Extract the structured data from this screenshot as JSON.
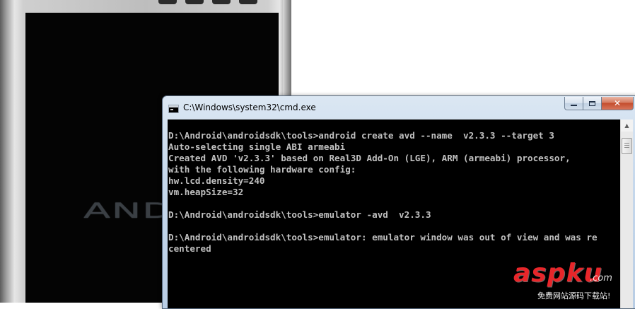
{
  "emulator": {
    "boot_logo_text": "ANDRO"
  },
  "cmd_window": {
    "title": "C:\\Windows\\system32\\cmd.exe",
    "controls": {
      "minimize": "",
      "maximize": "",
      "close": "✕"
    },
    "console_lines": [
      "",
      "D:\\Android\\androidsdk\\tools>android create avd --name  v2.3.3 --target 3",
      "Auto-selecting single ABI armeabi",
      "Created AVD 'v2.3.3' based on Real3D Add-On (LGE), ARM (armeabi) processor,",
      "with the following hardware config:",
      "hw.lcd.density=240",
      "vm.heapSize=32",
      "",
      "D:\\Android\\androidsdk\\tools>emulator -avd  v2.3.3",
      "",
      "D:\\Android\\androidsdk\\tools>emulator: emulator window was out of view and was re",
      "centered"
    ]
  },
  "watermark": {
    "logo": "aspku",
    "suffix": ".com",
    "tagline": "免费网站源码下载站!"
  }
}
